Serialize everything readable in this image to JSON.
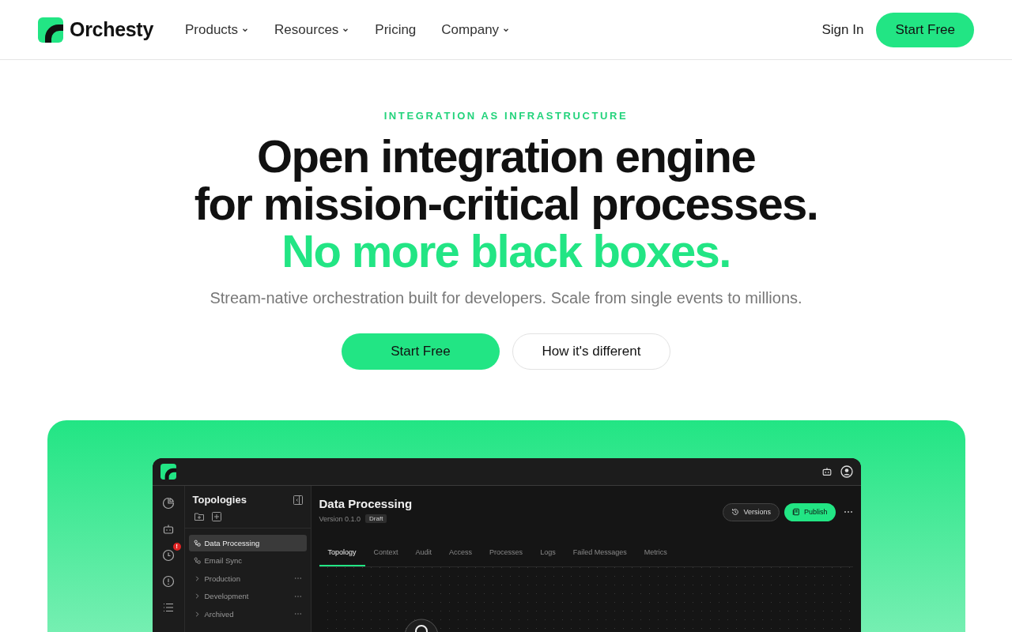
{
  "header": {
    "logo": "Orchesty",
    "nav": [
      {
        "label": "Products",
        "dropdown": true
      },
      {
        "label": "Resources",
        "dropdown": true
      },
      {
        "label": "Pricing",
        "dropdown": false
      },
      {
        "label": "Company",
        "dropdown": true
      }
    ],
    "sign_in": "Sign In",
    "cta": "Start Free"
  },
  "hero": {
    "eyebrow": "INTEGRATION AS INFRASTRUCTURE",
    "title_lines": [
      "Open integration engine",
      "for mission-critical processes."
    ],
    "title_accent": "No more black boxes.",
    "subtitle": "Stream-native orchestration built for developers. Scale from single events to millions.",
    "primary_button": "Start Free",
    "secondary_button": "How it's different"
  },
  "app": {
    "rail_badge": "!",
    "sidebar": {
      "title": "Topologies",
      "items": [
        {
          "kind": "topology",
          "label": "Data Processing",
          "selected": true
        },
        {
          "kind": "topology",
          "label": "Email Sync",
          "selected": false
        },
        {
          "kind": "folder",
          "label": "Production",
          "selected": false
        },
        {
          "kind": "folder",
          "label": "Development",
          "selected": false
        },
        {
          "kind": "folder",
          "label": "Archived",
          "selected": false
        }
      ]
    },
    "main": {
      "title": "Data Processing",
      "version": "Version 0.1.0",
      "status": "Draft",
      "versions_button": "Versions",
      "publish_button": "Publish",
      "tabs": [
        {
          "label": "Topology",
          "selected": true
        },
        {
          "label": "Context",
          "selected": false
        },
        {
          "label": "Audit",
          "selected": false
        },
        {
          "label": "Access",
          "selected": false
        },
        {
          "label": "Processes",
          "selected": false
        },
        {
          "label": "Logs",
          "selected": false
        },
        {
          "label": "Failed Messages",
          "selected": false
        },
        {
          "label": "Metrics",
          "selected": false
        }
      ]
    }
  }
}
